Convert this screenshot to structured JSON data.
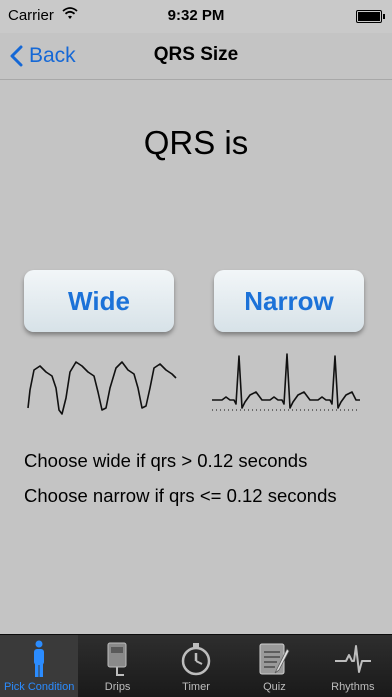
{
  "status": {
    "carrier": "Carrier",
    "time": "9:32 PM"
  },
  "nav": {
    "back_label": "Back",
    "title": "QRS Size"
  },
  "main": {
    "heading": "QRS is",
    "wide_button": "Wide",
    "narrow_button": "Narrow",
    "hint_wide": "Choose wide if qrs > 0.12 seconds",
    "hint_narrow": "Choose narrow if qrs <= 0.12 seconds"
  },
  "tabs": [
    {
      "label": "Pick Condition",
      "icon": "person-icon",
      "active": true
    },
    {
      "label": "Drips",
      "icon": "iv-bag-icon",
      "active": false
    },
    {
      "label": "Timer",
      "icon": "stopwatch-icon",
      "active": false
    },
    {
      "label": "Quiz",
      "icon": "notepad-icon",
      "active": false
    },
    {
      "label": "Rhythms",
      "icon": "ecg-pulse-icon",
      "active": false
    }
  ],
  "colors": {
    "accent": "#1568d6",
    "active_tab": "#2b8cff",
    "tabbar": "#222222"
  }
}
